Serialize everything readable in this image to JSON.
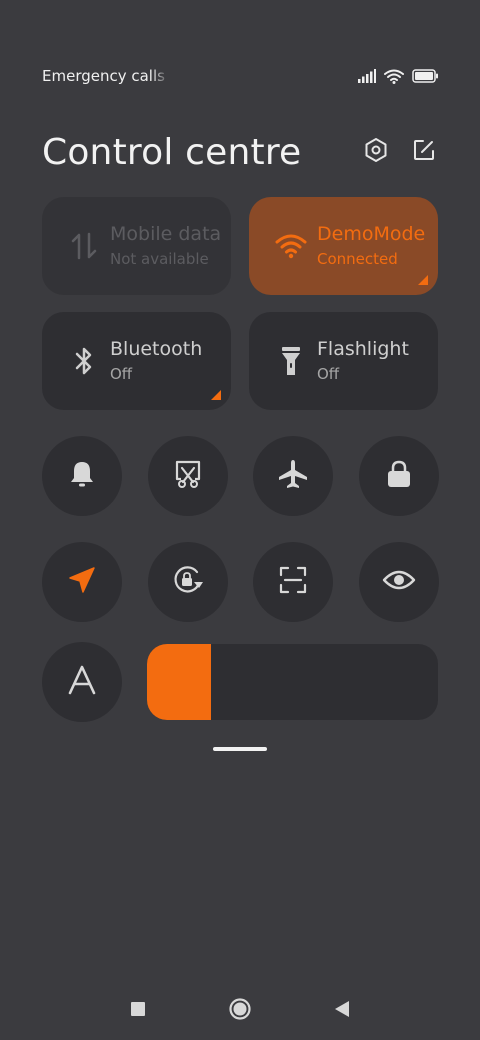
{
  "status_bar": {
    "carrier_text": "Emergency calls only",
    "icons": [
      "signal-icon",
      "wifi-icon",
      "battery-icon"
    ]
  },
  "header": {
    "title": "Control centre",
    "actions": [
      "settings-hexagon-icon",
      "edit-icon"
    ]
  },
  "tiles": [
    {
      "id": "mobile-data",
      "label": "Mobile data",
      "sub": "Not available",
      "icon": "mobile-data-arrows-icon",
      "state": "disabled"
    },
    {
      "id": "wifi",
      "label": "DemoMode",
      "sub": "Connected",
      "icon": "wifi-icon",
      "state": "active"
    },
    {
      "id": "bluetooth",
      "label": "Bluetooth",
      "sub": "Off",
      "icon": "bluetooth-icon",
      "state": "off"
    },
    {
      "id": "flashlight",
      "label": "Flashlight",
      "sub": "Off",
      "icon": "flashlight-icon",
      "state": "off"
    }
  ],
  "toggles_row1": [
    "bell-icon",
    "screenshot-scissors-icon",
    "airplane-icon",
    "lock-icon"
  ],
  "toggles_row2": [
    "location-arrow-icon",
    "rotation-lock-icon",
    "scan-icon",
    "eye-icon"
  ],
  "brightness": {
    "icon": "auto-brightness-icon",
    "glyph": "A",
    "level": 0.22
  },
  "nav": [
    "recents-square-icon",
    "home-circle-icon",
    "back-triangle-icon"
  ],
  "colors": {
    "accent": "#f36c10",
    "background": "#3b3b3f",
    "tile": "#2e2e32",
    "active_tile": "#8a4a27"
  }
}
